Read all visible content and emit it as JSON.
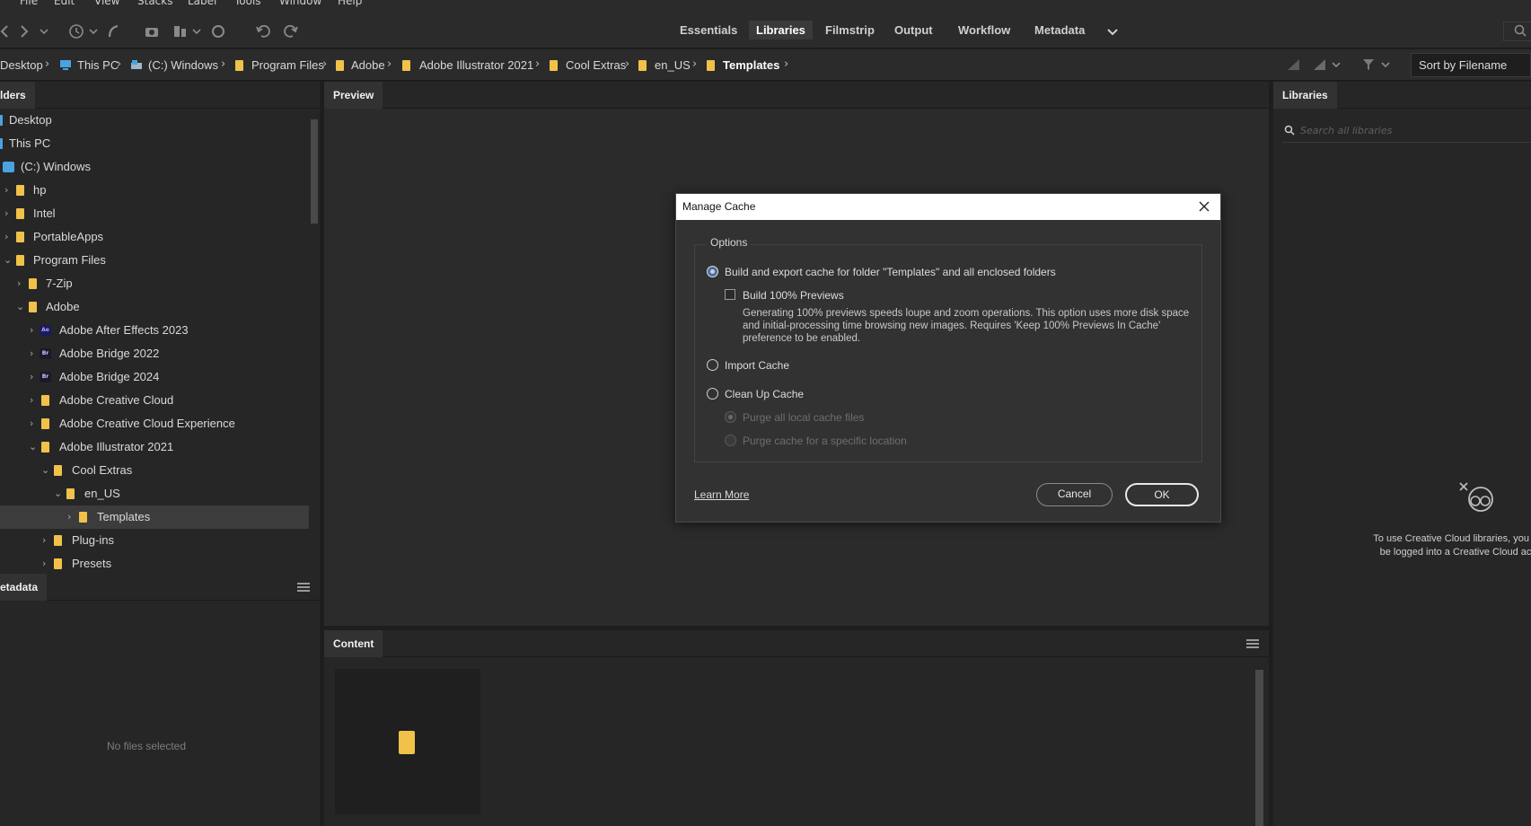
{
  "menu": [
    "File",
    "Edit",
    "View",
    "Stacks",
    "Label",
    "Tools",
    "Window",
    "Help"
  ],
  "workspaces": {
    "essentials": "Essentials",
    "libraries": "Libraries",
    "filmstrip": "Filmstrip",
    "output": "Output",
    "workflow": "Workflow",
    "metadata": "Metadata"
  },
  "breadcrumb": {
    "desktop": "Desktop",
    "thispc": "This PC",
    "drive": "(C:) Windows",
    "programfiles": "Program Files",
    "adobe": "Adobe",
    "illustrator": "Adobe Illustrator 2021",
    "coolextras": "Cool Extras",
    "enus": "en_US",
    "templates": "Templates"
  },
  "sort": {
    "label": "Sort by Filename"
  },
  "panels": {
    "folders": "lders",
    "preview": "Preview",
    "libraries": "Libraries",
    "metadata": "etadata",
    "content": "Content"
  },
  "tree": {
    "desktop": "Desktop",
    "thispc": "This PC",
    "drive": "(C:) Windows",
    "hp": "hp",
    "intel": "Intel",
    "portableapps": "PortableApps",
    "programfiles": "Program Files",
    "zip": "7-Zip",
    "adobe": "Adobe",
    "ae": "Adobe After Effects 2023",
    "br22": "Adobe Bridge 2022",
    "br24": "Adobe Bridge 2024",
    "acc": "Adobe Creative Cloud",
    "acce": "Adobe Creative Cloud Experience",
    "ai": "Adobe Illustrator 2021",
    "coolextras": "Cool Extras",
    "enus": "en_US",
    "templates": "Templates",
    "plugins": "Plug-ins",
    "presets": "Presets",
    "ae_badge": "Ae",
    "br_badge": "Br"
  },
  "metadata": {
    "empty": "No files selected"
  },
  "libraries": {
    "search_placeholder": "Search all libraries",
    "message": "To use Creative Cloud libraries, you need to be logged into a Creative Cloud account."
  },
  "dialog": {
    "title": "Manage Cache",
    "options_legend": "Options",
    "build_export": "Build and export cache for folder \"Templates\" and all enclosed folders",
    "build_100": "Build 100% Previews",
    "description": "Generating 100% previews speeds loupe and zoom operations. This option uses more disk space and initial-processing time browsing new images. Requires 'Keep 100% Previews In Cache' preference to be enabled.",
    "import_cache": "Import Cache",
    "cleanup_cache": "Clean Up Cache",
    "purge_all": "Purge all local cache files",
    "purge_specific": "Purge cache for a specific location",
    "learn_more": "Learn More",
    "cancel": "Cancel",
    "ok": "OK"
  },
  "colors": {
    "folder": "#f1c24a",
    "background": "#1e1e1e",
    "panel": "#262626"
  }
}
